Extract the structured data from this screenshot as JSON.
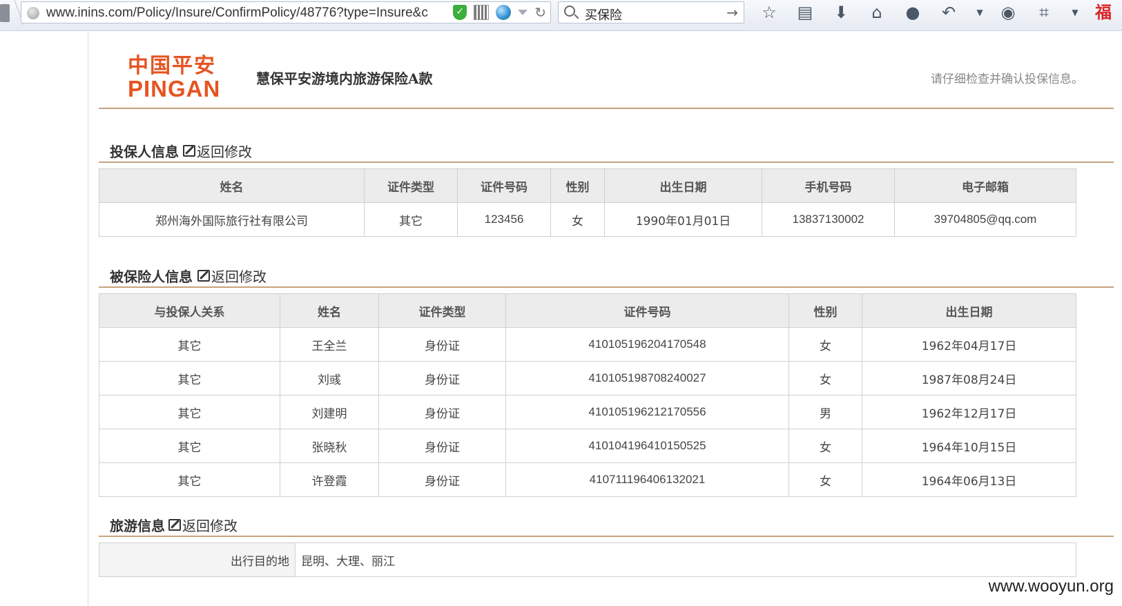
{
  "browser": {
    "url": "www.inins.com/Policy/Insure/ConfirmPolicy/48776?type=Insure&c",
    "search_text": "买保险"
  },
  "header": {
    "logo_cn": "中国平安",
    "logo_en": "PINGAN",
    "product_title": "慧保平安游境内旅游保险A款",
    "notice": "请仔细检查并确认投保信息。"
  },
  "policyholder": {
    "title": "投保人信息",
    "edit_label": "返回修改",
    "columns": [
      "姓名",
      "证件类型",
      "证件号码",
      "性别",
      "出生日期",
      "手机号码",
      "电子邮箱"
    ],
    "row": [
      "郑州海外国际旅行社有限公司",
      "其它",
      "123456",
      "女",
      "1990年01月01日",
      "13837130002",
      "39704805@qq.com"
    ]
  },
  "insured": {
    "title": "被保险人信息",
    "edit_label": "返回修改",
    "columns": [
      "与投保人关系",
      "姓名",
      "证件类型",
      "证件号码",
      "性别",
      "出生日期"
    ],
    "rows": [
      [
        "其它",
        "王全兰",
        "身份证",
        "410105196204170548",
        "女",
        "1962年04月17日"
      ],
      [
        "其它",
        "刘彧",
        "身份证",
        "410105198708240027",
        "女",
        "1987年08月24日"
      ],
      [
        "其它",
        "刘建明",
        "身份证",
        "410105196212170556",
        "男",
        "1962年12月17日"
      ],
      [
        "其它",
        "张晓秋",
        "身份证",
        "410104196410150525",
        "女",
        "1964年10月15日"
      ],
      [
        "其它",
        "许登霞",
        "身份证",
        "410711196406132021",
        "女",
        "1964年06月13日"
      ]
    ]
  },
  "travel": {
    "title": "旅游信息",
    "edit_label": "返回修改",
    "destination_label": "出行目的地",
    "destination_value": "昆明、大理、丽江"
  },
  "watermark": "www.wooyun.org"
}
